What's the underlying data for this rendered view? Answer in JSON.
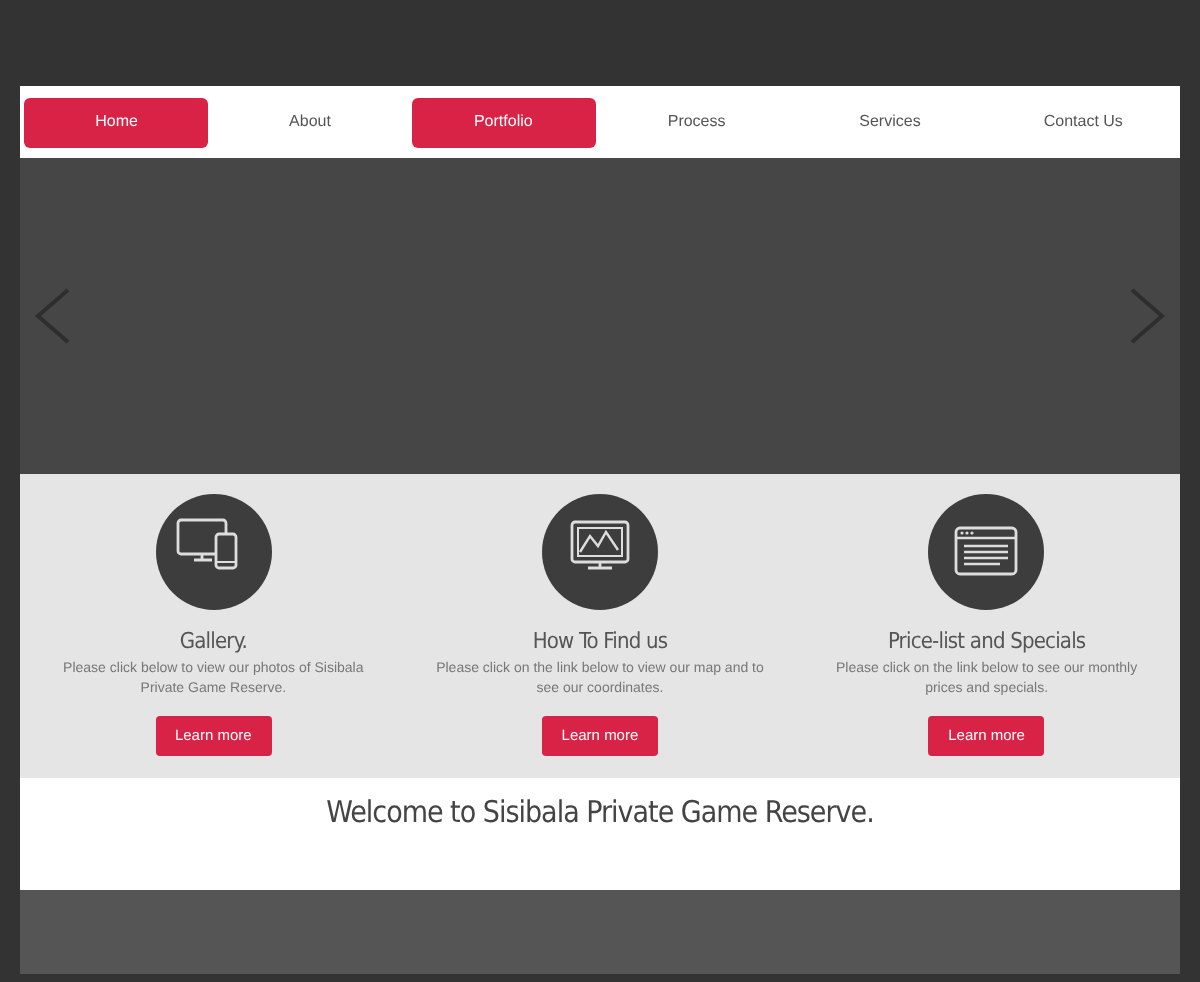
{
  "nav": [
    {
      "label": "Home",
      "selected": true
    },
    {
      "label": "About",
      "selected": false
    },
    {
      "label": "Portfolio",
      "selected": true
    },
    {
      "label": "Process",
      "selected": false
    },
    {
      "label": "Services",
      "selected": false
    },
    {
      "label": "Contact Us",
      "selected": false
    }
  ],
  "features": [
    {
      "kind": "devices",
      "title": "Gallery.",
      "text": "Please click below to view our photos of Sisibala Private Game Reserve.",
      "button": "Learn more"
    },
    {
      "kind": "chart",
      "title": "How To Find us",
      "text": "Please click on the link below to view our map and to see our coordinates.",
      "button": "Learn more"
    },
    {
      "kind": "browser",
      "title": "Price-list and Specials",
      "text": "Please click on the link below to see our monthly prices and specials.",
      "button": "Learn more"
    }
  ],
  "welcome": "Welcome to Sisibala Private Game Reserve."
}
